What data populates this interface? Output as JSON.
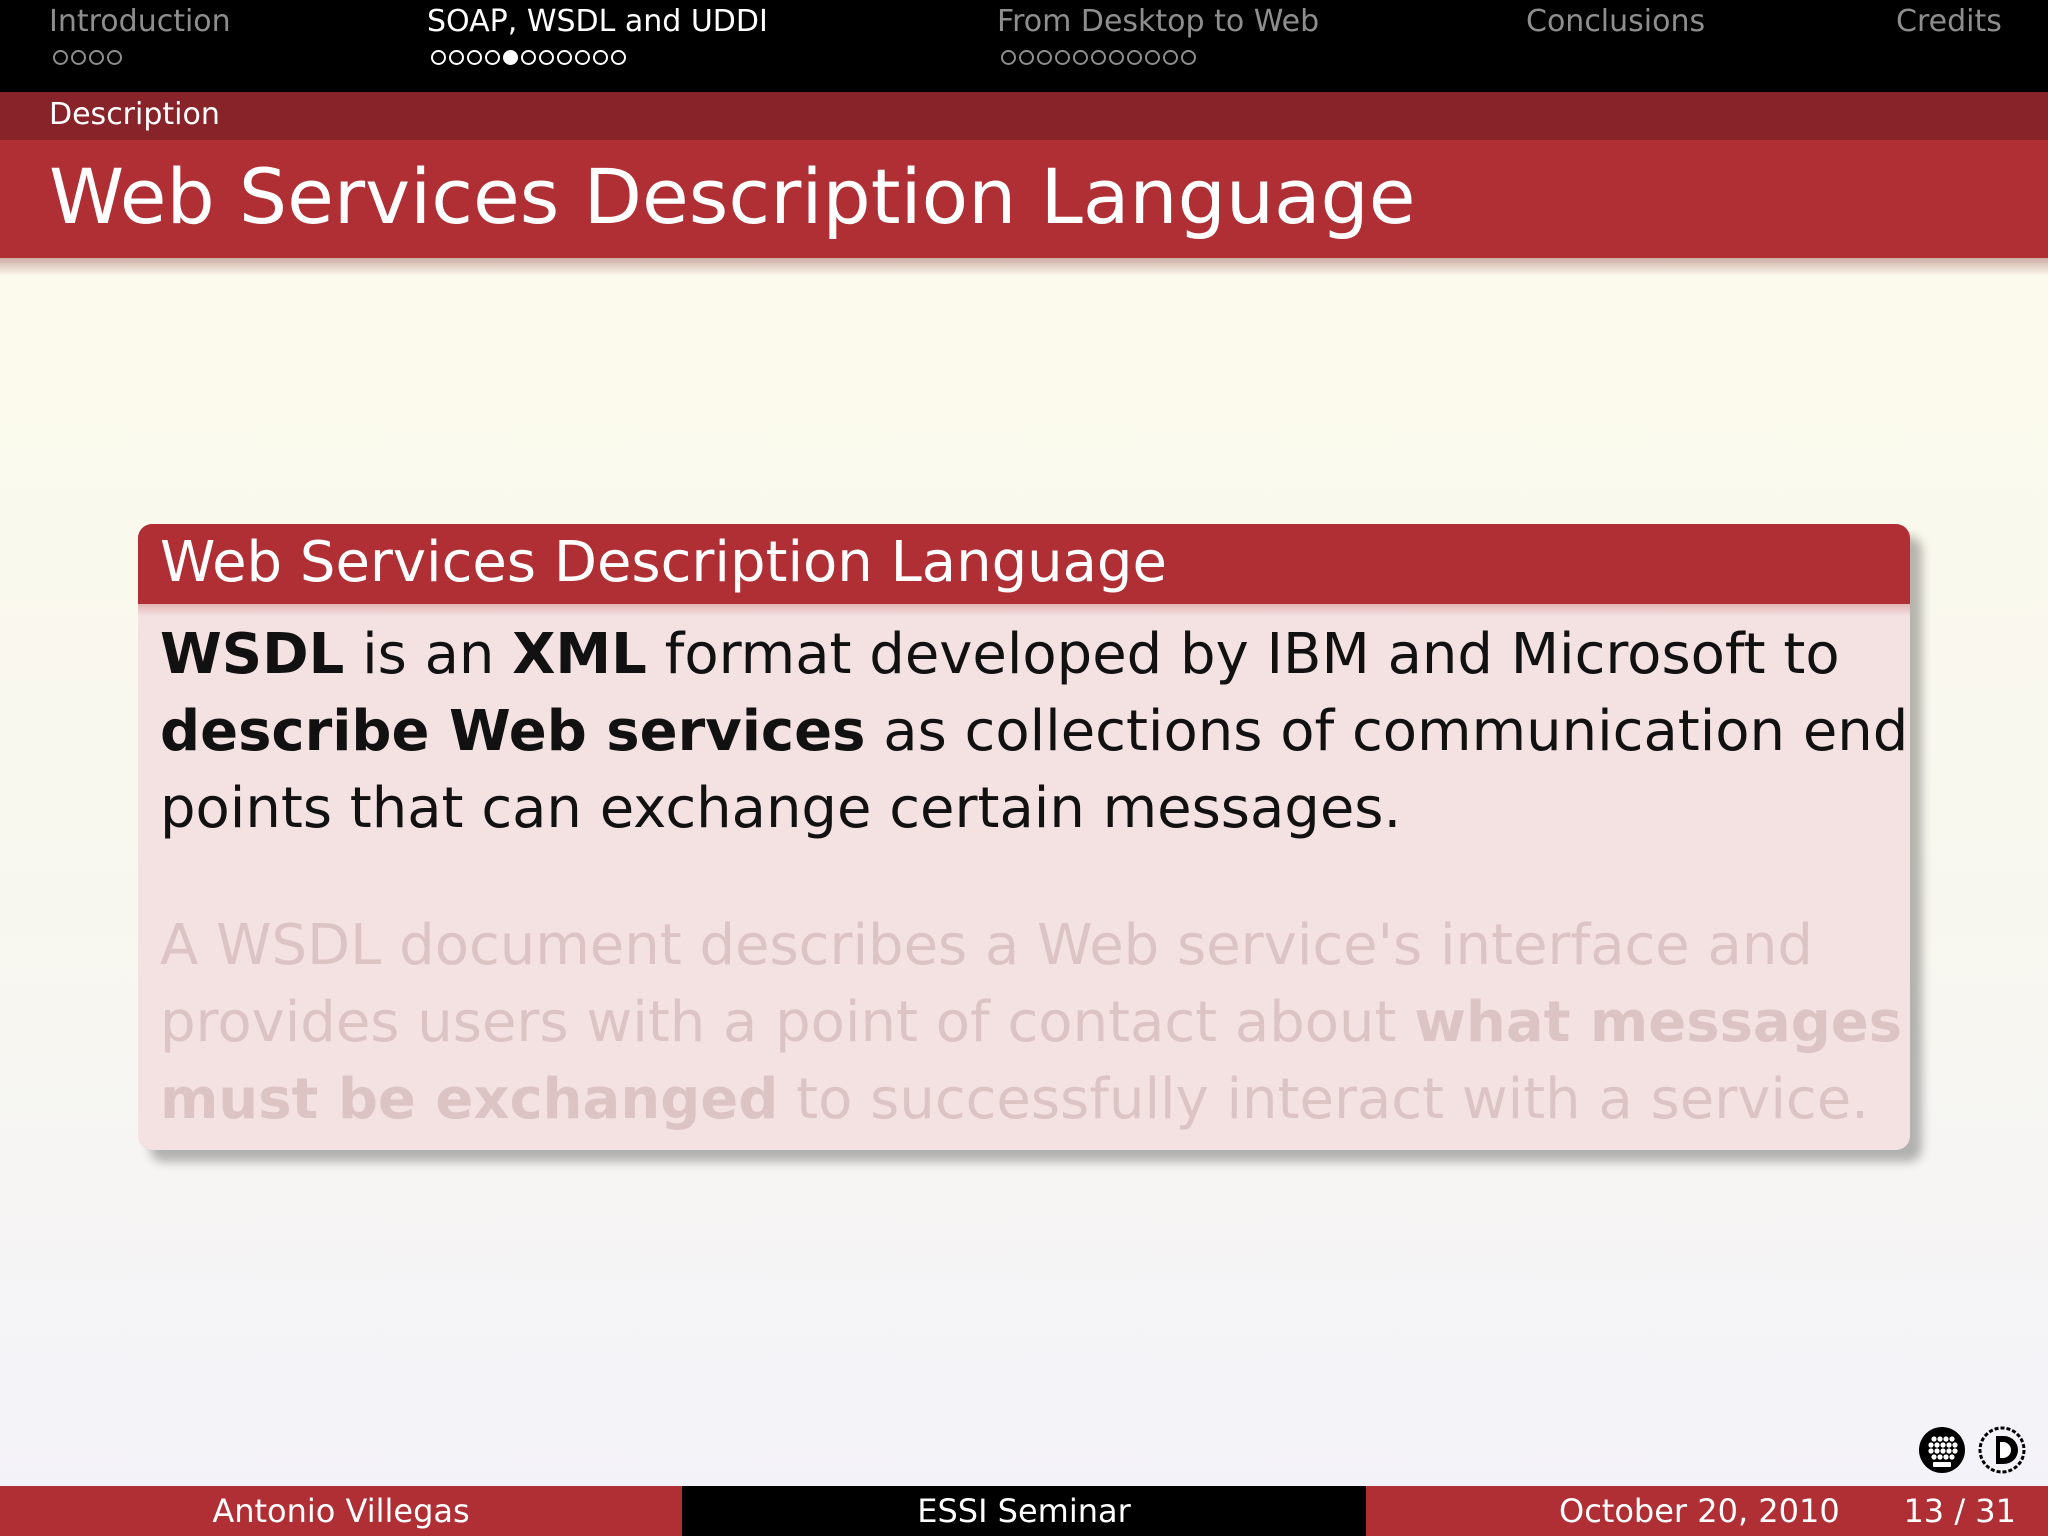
{
  "navigation": {
    "sections": [
      {
        "title": "Introduction",
        "dots": 4,
        "active": false,
        "current_dot": null
      },
      {
        "title": "SOAP, WSDL and UDDI",
        "dots": 11,
        "active": true,
        "current_dot": 5
      },
      {
        "title": "From Desktop to Web",
        "dots": 11,
        "active": false,
        "current_dot": null
      },
      {
        "title": "Conclusions",
        "dots": 0,
        "active": false,
        "current_dot": null
      },
      {
        "title": "Credits",
        "dots": 0,
        "active": false,
        "current_dot": null
      }
    ]
  },
  "subsection": "Description",
  "frame_title": "Web Services Description Language",
  "block": {
    "title": "Web Services Description Language",
    "paragraph1": {
      "line1": {
        "b1": "WSDL",
        "t1": " is an ",
        "b2": "XML",
        "t2": " format developed by IBM and Microsoft to"
      },
      "line2": {
        "b1": "describe Web services",
        "t1": " as collections of communication end"
      },
      "line3": {
        "t1": "points that can exchange certain messages."
      }
    },
    "paragraph2": {
      "line1": {
        "t1": "A WSDL document describes a Web service's interface and"
      },
      "line2": {
        "t1": "provides users with a point of contact about ",
        "b1": "what messages"
      },
      "line3": {
        "b1": "must be exchanged",
        "t1": " to successfully interact with a service."
      }
    }
  },
  "logos": {
    "left": "upc-logo-icon",
    "right": "doctorate-logo-icon"
  },
  "footer": {
    "author": "Antonio Villegas",
    "event": "ESSI Seminar",
    "date": "October 20, 2010",
    "page": "13 / 31"
  },
  "colors": {
    "accent_red": "#b02f35",
    "dark_red": "#88232a",
    "block_body": "#f4e1e2",
    "nav_inactive": "#8e8e8e"
  }
}
